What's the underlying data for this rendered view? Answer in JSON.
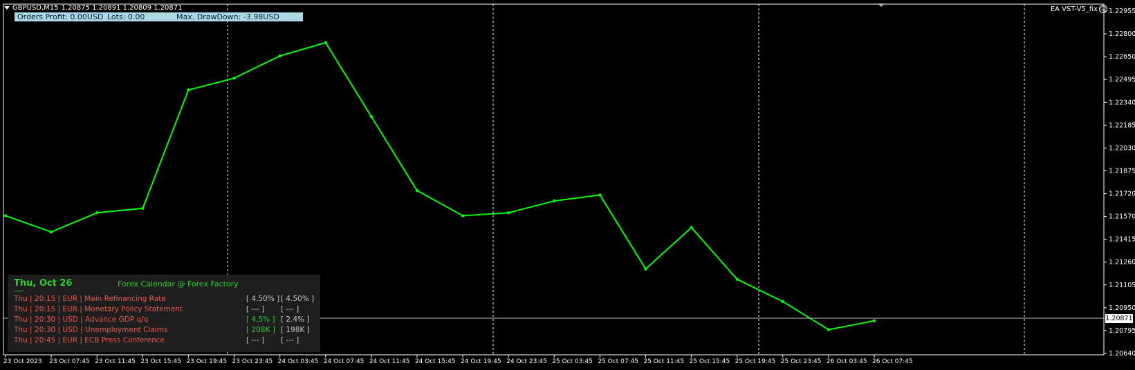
{
  "header": {
    "symbol": "GBPUSD,M15",
    "ohlc": "1.20875 1.20891 1.20809 1.20871"
  },
  "info_bar": {
    "orders_profit": "Orders Profit: 0.00USD",
    "lots": "Lots: 0.00",
    "max_drawdown": "Max. DrawDown: -3.98USD"
  },
  "ea_label": "EA VST-V5_fix",
  "price_axis": [
    "1.22955",
    "1.22800",
    "1.22650",
    "1.22495",
    "1.22340",
    "1.22185",
    "1.22030",
    "1.21875",
    "1.21720",
    "1.21570",
    "1.21415",
    "1.21260",
    "1.21105",
    "1.20950",
    "1.20795",
    "1.20640"
  ],
  "current_price": "1.20871",
  "time_axis": [
    "23 Oct 2023",
    "23 Oct 07:45",
    "23 Oct 11:45",
    "23 Oct 15:45",
    "23 Oct 19:45",
    "23 Oct 23:45",
    "24 Oct 03:45",
    "24 Oct 07:45",
    "24 Oct 11:45",
    "24 Oct 15:45",
    "24 Oct 19:45",
    "24 Oct 23:45",
    "25 Oct 03:45",
    "25 Oct 07:45",
    "25 Oct 11:45",
    "25 Oct 15:45",
    "25 Oct 19:45",
    "25 Oct 23:45",
    "26 Oct 03:45",
    "26 Oct 07:45"
  ],
  "calendar": {
    "date": "Thu, Oct 26",
    "title": "Forex Calendar @ Forex Factory",
    "separator": "------",
    "events": [
      {
        "text": "Thu  |  20:15  |  EUR  |  Main Refinancing Rate",
        "actual": "[ 4.50% ]",
        "forecast": "[ 4.50% ]",
        "actual_color": "#c8c8c8"
      },
      {
        "text": "Thu  |  20:15  |  EUR  |  Monetary Policy Statement",
        "actual": "[ --- ]",
        "forecast": "[ --- ]",
        "actual_color": "#c8c8c8"
      },
      {
        "text": "Thu  |  20:30  |  USD  |  Advance GDP q/q",
        "actual": "[ 4.5% ]",
        "forecast": "[ 2.4% ]",
        "actual_color": "#32cd32"
      },
      {
        "text": "Thu  |  20:30  |  USD  |  Unemployment Claims",
        "actual": "[ 208K ]",
        "forecast": "[ 198K ]",
        "actual_color": "#32cd32"
      },
      {
        "text": "Thu  |  20:45  |  EUR  |  ECB Press Conference",
        "actual": "[ --- ]",
        "forecast": "[ --- ]",
        "actual_color": "#c8c8c8"
      }
    ]
  },
  "colors": {
    "background": "#000000",
    "candles": "#00ff00",
    "grid": "#ffffff",
    "info_bar": "#add8e6",
    "calendar_bg": "#1e1e1e",
    "event_text": "#e55a4a"
  },
  "chart_data": {
    "type": "line",
    "xlabel": "",
    "ylabel": "",
    "ylim": [
      1.2064,
      1.2301
    ],
    "categories": [
      "23 Oct 2023",
      "23 Oct 07:45",
      "23 Oct 11:45",
      "23 Oct 15:45",
      "23 Oct 19:45",
      "23 Oct 23:45",
      "24 Oct 03:45",
      "24 Oct 07:45",
      "24 Oct 11:45",
      "24 Oct 15:45",
      "24 Oct 19:45",
      "24 Oct 23:45",
      "25 Oct 03:45",
      "25 Oct 07:45",
      "25 Oct 11:45",
      "25 Oct 15:45",
      "25 Oct 19:45",
      "25 Oct 23:45",
      "26 Oct 03:45",
      "26 Oct 07:45"
    ],
    "values": [
      1.2158,
      1.2147,
      1.216,
      1.2163,
      1.2243,
      1.2251,
      1.2266,
      1.2275,
      1.2225,
      1.2175,
      1.2158,
      1.216,
      1.2168,
      1.2172,
      1.2122,
      1.215,
      1.2115,
      1.21,
      1.2081,
      1.2087
    ],
    "current_value": 1.20871
  }
}
